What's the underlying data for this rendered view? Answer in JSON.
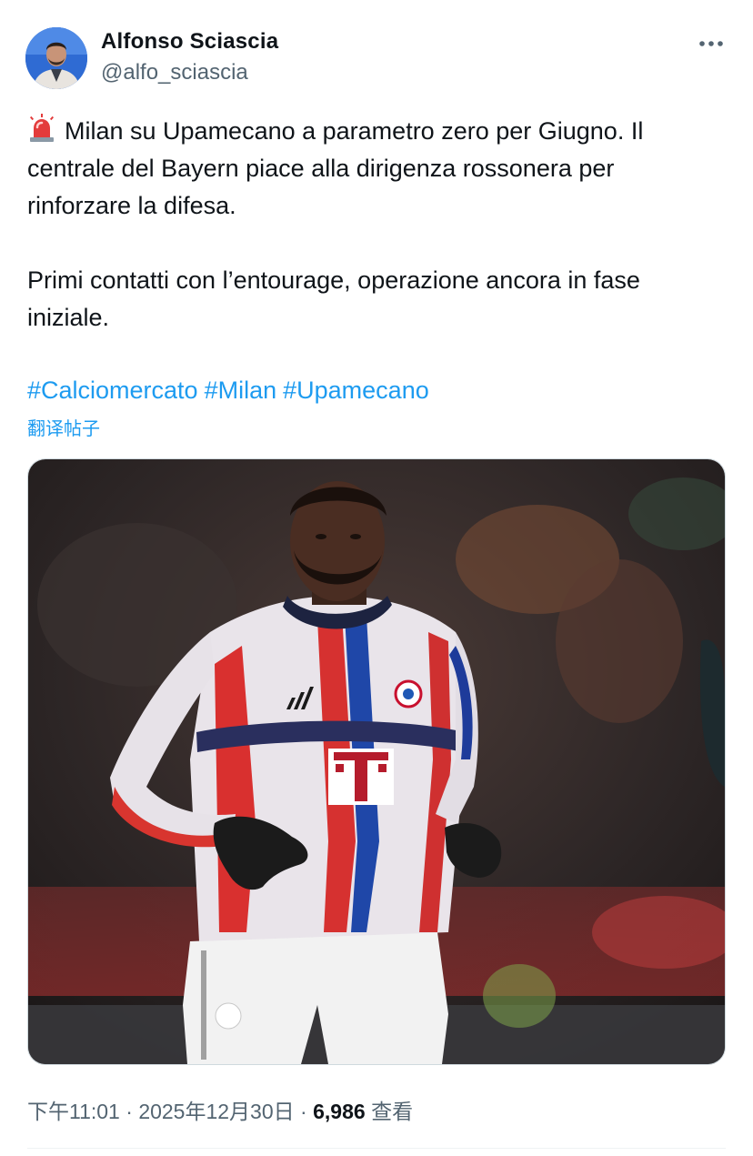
{
  "author": {
    "display_name": "Alfonso Sciascia",
    "handle": "@alfo_sciascia"
  },
  "tweet": {
    "line1": "Milan su Upamecano a parametro zero per Giugno. Il",
    "line2": "centrale del Bayern piace alla dirigenza rossonera per",
    "line3": "rinforzare la difesa.",
    "line4": "Primi contatti con l’entourage, operazione ancora in fase",
    "line5": "iniziale.",
    "emoji_icon": "police-light-emoji",
    "hashtags": [
      "#Calciomercato",
      "#Milan",
      "#Upamecano"
    ]
  },
  "translate_label": "翻译帖子",
  "media": {
    "description_icon": "football-player-photo"
  },
  "meta": {
    "time": "下午11:01",
    "separator": "·",
    "date": "2025年12月30日",
    "views": "6,986",
    "views_label": "查看"
  },
  "colors": {
    "link": "#1d9bf0",
    "secondary_text": "#536471",
    "primary_text": "#0f1419",
    "border": "#cfd9de"
  }
}
